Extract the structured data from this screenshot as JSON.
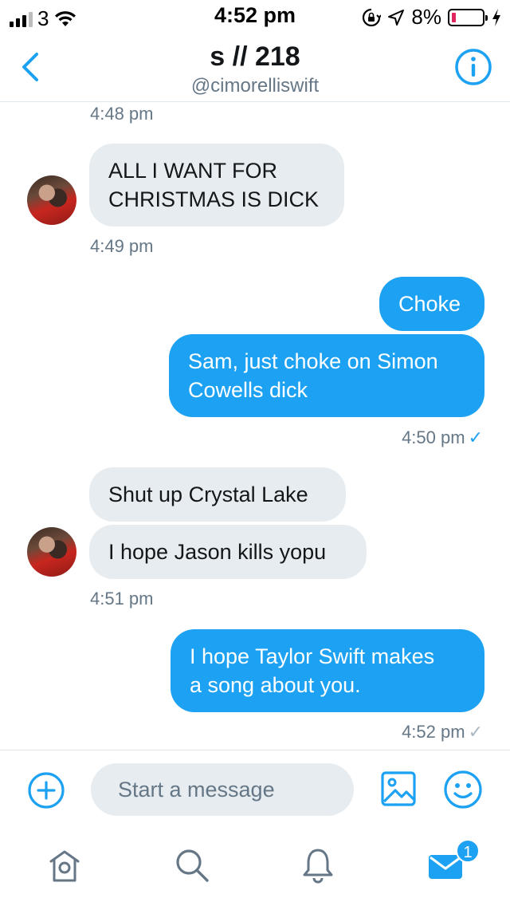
{
  "status_bar": {
    "carrier": "3",
    "time": "4:52 pm",
    "battery_percent": "8%",
    "battery_level": 0.08,
    "icons": [
      "signal-icon",
      "wifi-icon",
      "orientation-lock-icon",
      "location-icon",
      "battery-icon",
      "charging-icon"
    ]
  },
  "header": {
    "title": "s // 218",
    "handle": "@cimorelliswift"
  },
  "messages": [
    {
      "type": "timestamp",
      "text": "4:48 pm",
      "side": "left"
    },
    {
      "type": "bubble",
      "side": "in",
      "text": "ALL I WANT FOR CHRISTMAS IS DICK",
      "line1": "ALL I WANT FOR",
      "line2": "CHRISTMAS IS DICK"
    },
    {
      "type": "timestamp",
      "text": "4:49 pm",
      "side": "left"
    },
    {
      "type": "bubble",
      "side": "out",
      "text": "Choke"
    },
    {
      "type": "bubble",
      "side": "out",
      "text": "Sam, just choke on Simon Cowells dick",
      "line1": "Sam, just choke on Simon",
      "line2": "Cowells dick"
    },
    {
      "type": "timestamp",
      "text": "4:50 pm",
      "side": "right",
      "check": "✓"
    },
    {
      "type": "bubble",
      "side": "in",
      "text": "Shut up Crystal Lake"
    },
    {
      "type": "bubble",
      "side": "in",
      "text": "I hope Jason kills yopu"
    },
    {
      "type": "timestamp",
      "text": "4:51 pm",
      "side": "left"
    },
    {
      "type": "bubble",
      "side": "out",
      "text": "I hope Taylor Swift makes a song about you.",
      "line1": "I hope Taylor Swift makes",
      "line2": "a song about you."
    },
    {
      "type": "timestamp",
      "text": "4:52 pm",
      "side": "right",
      "check": "✓"
    }
  ],
  "composer": {
    "placeholder": "Start a message"
  },
  "tabs": {
    "messages_badge": "1"
  },
  "colors": {
    "accent": "#1da1f2",
    "incoming_bubble": "#e6ecf0",
    "secondary_text": "#657786"
  }
}
